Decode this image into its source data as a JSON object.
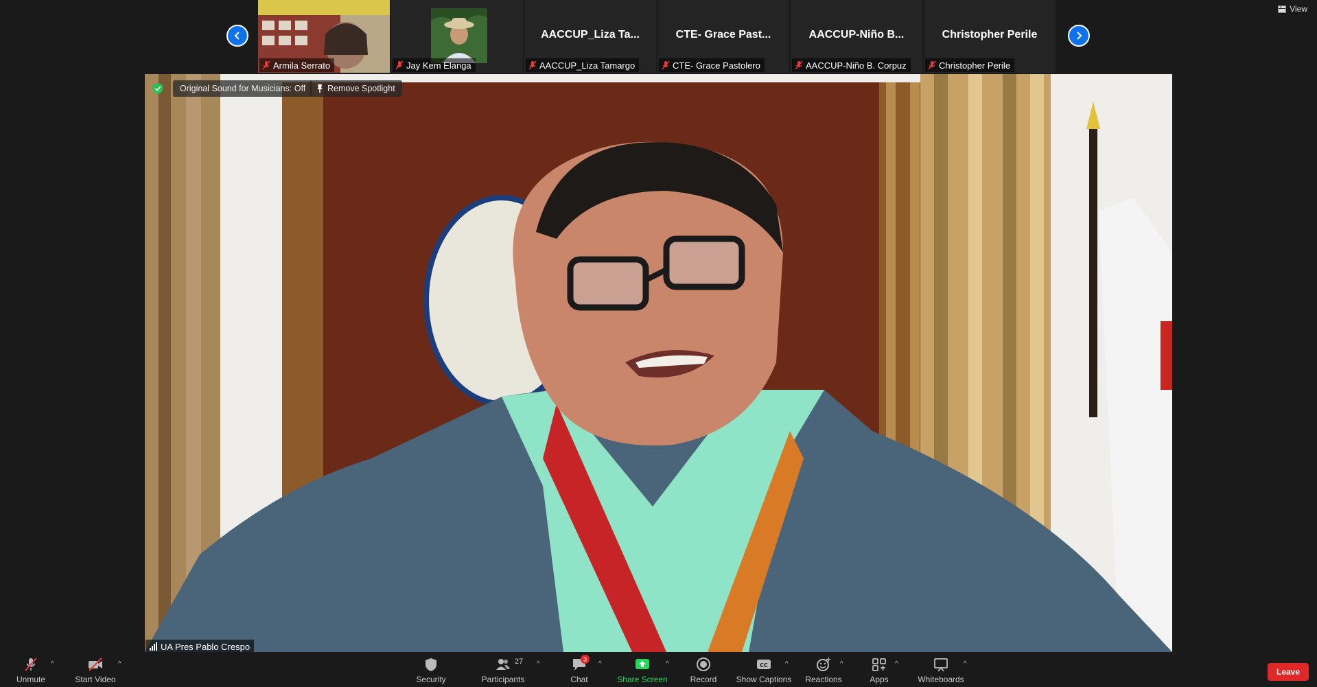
{
  "top_bar": {
    "view_label": "View",
    "thumbnails": [
      {
        "name": "Armila Serrato",
        "display_name": ""
      },
      {
        "name": "Jay Kem Elanga",
        "display_name": ""
      },
      {
        "name": "AACCUP_Liza Tamargo",
        "display_name": "AACCUP_Liza Ta..."
      },
      {
        "name": "CTE- Grace Pastolero",
        "display_name": "CTE- Grace Past..."
      },
      {
        "name": "AACCUP-Niño B. Corpuz",
        "display_name": "AACCUP-Niño B..."
      },
      {
        "name": "Christopher Perile",
        "display_name": "Christopher Perile"
      }
    ]
  },
  "overlay": {
    "original_sound": "Original Sound for Musicians: Off",
    "remove_spotlight": "Remove Spotlight"
  },
  "main_speaker": {
    "name": "UA Pres Pablo Crespo"
  },
  "toolbar": {
    "unmute": "Unmute",
    "start_video": "Start Video",
    "security": "Security",
    "participants": "Participants",
    "participants_count": "27",
    "chat": "Chat",
    "chat_badge": "3",
    "share_screen": "Share Screen",
    "record": "Record",
    "show_captions": "Show Captions",
    "reactions": "Reactions",
    "apps": "Apps",
    "whiteboards": "Whiteboards",
    "leave": "Leave"
  },
  "colors": {
    "accent": "#0e72ed",
    "share_green": "#23d959",
    "leave_red": "#e02828"
  }
}
